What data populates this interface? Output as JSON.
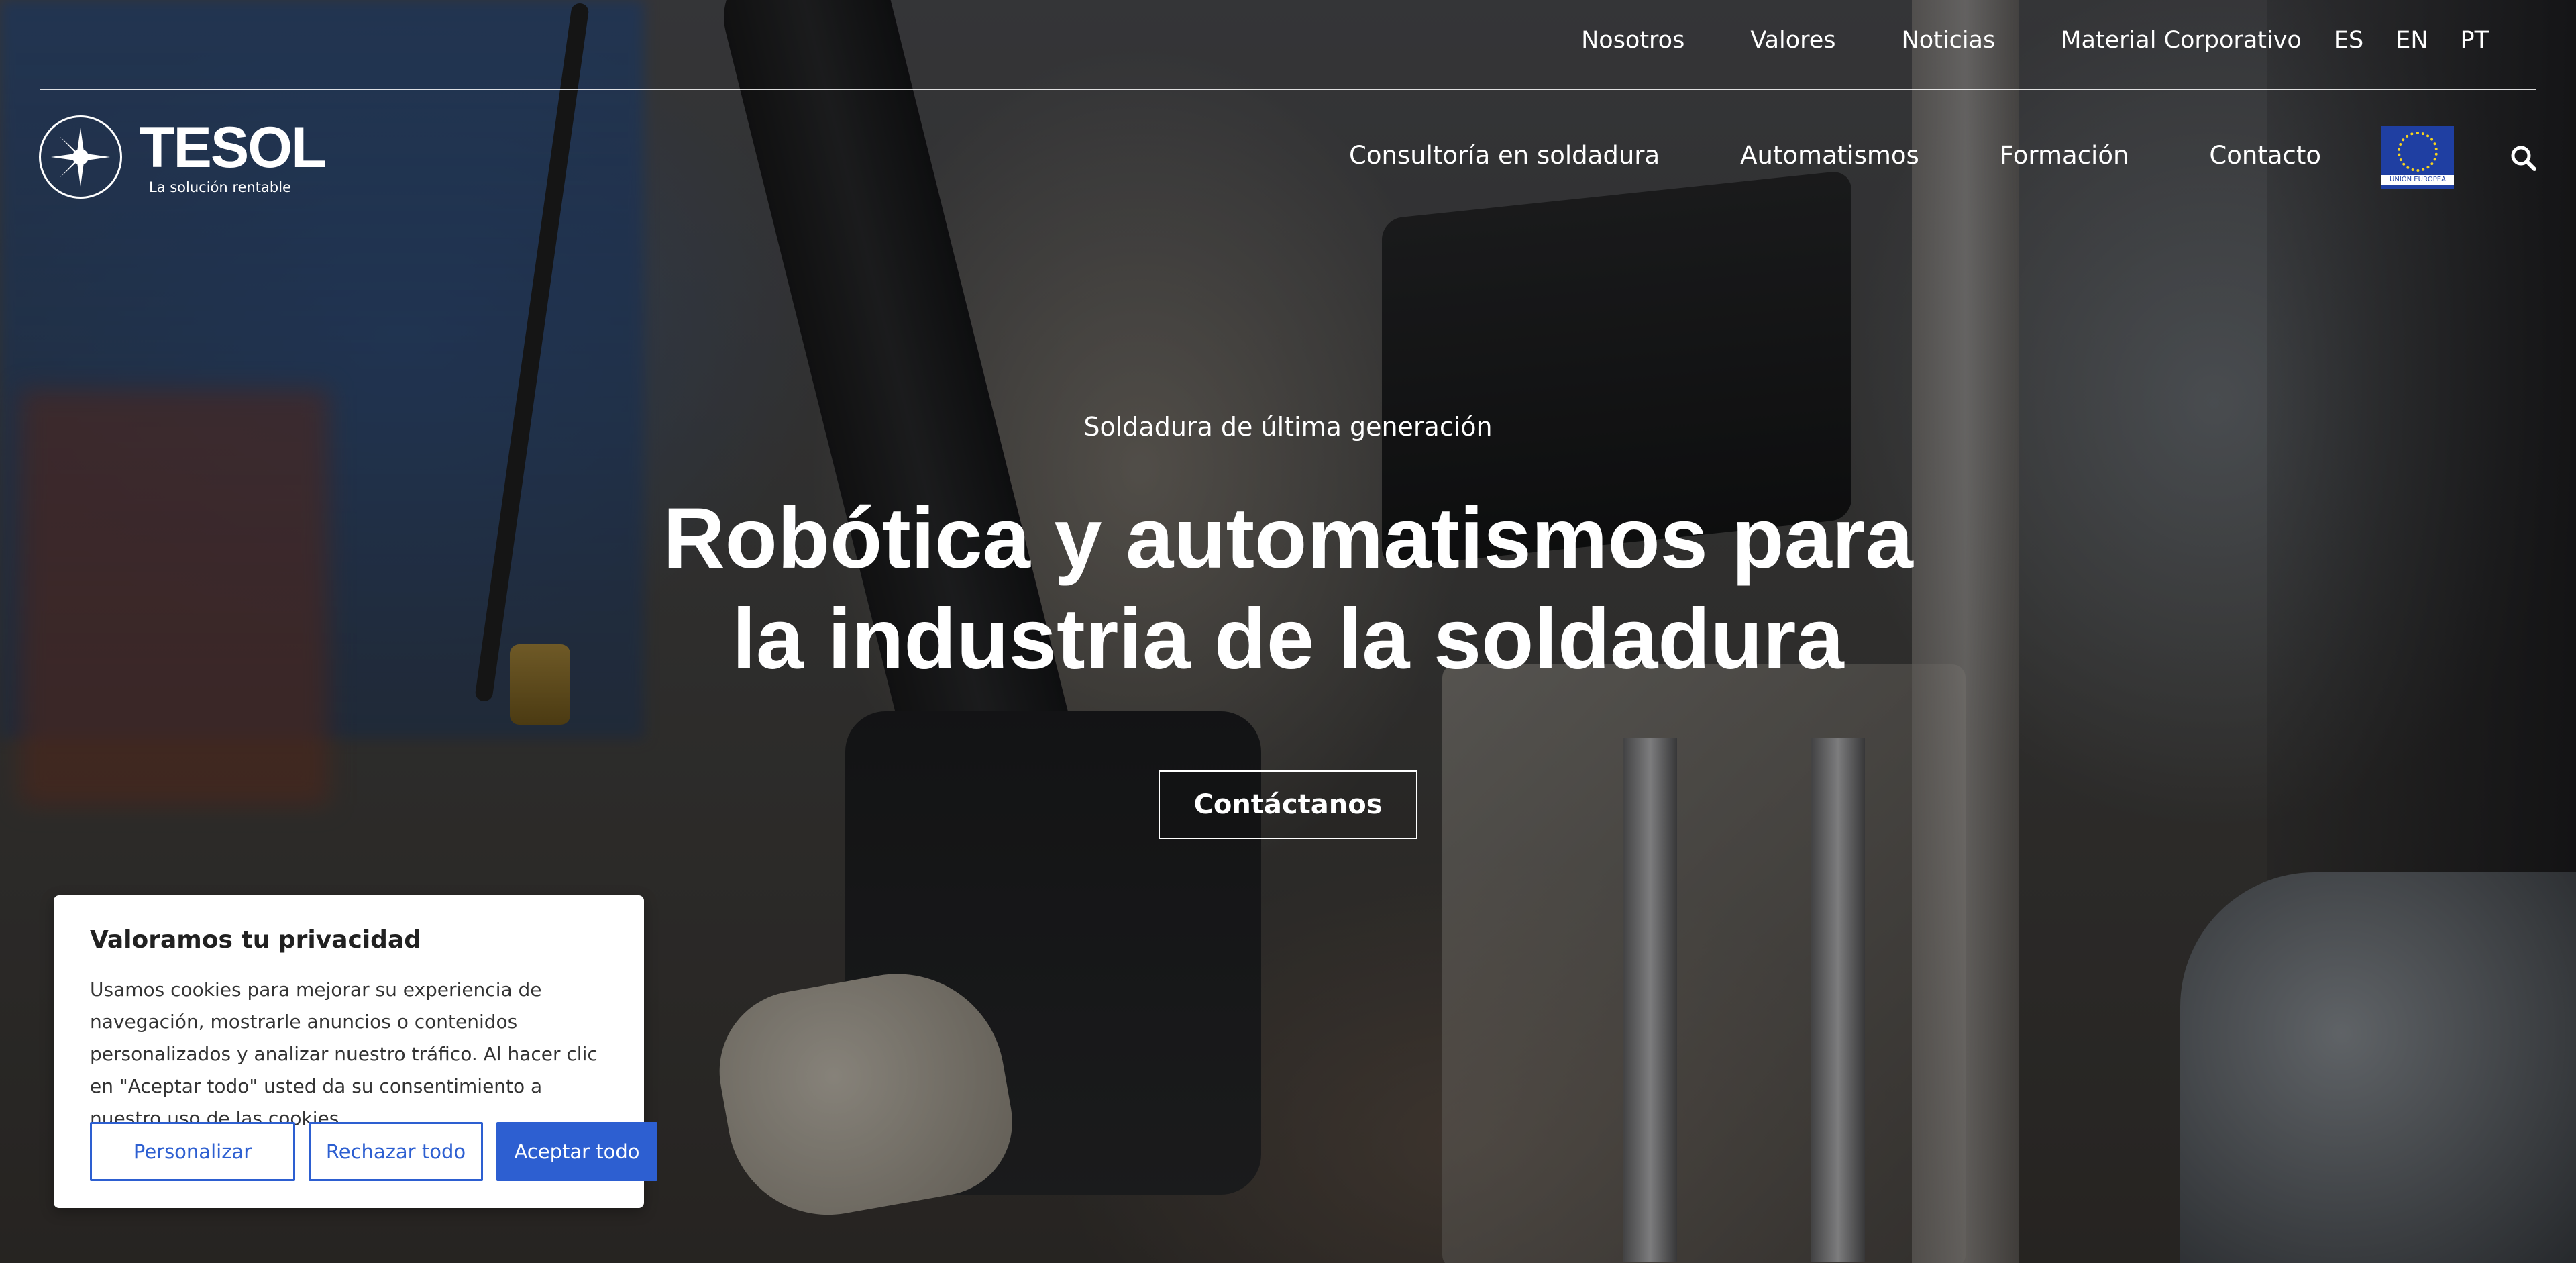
{
  "top_nav": {
    "items": [
      "Nosotros",
      "Valores",
      "Noticias",
      "Material Corporativo"
    ],
    "languages": [
      "ES",
      "EN",
      "PT"
    ]
  },
  "logo": {
    "name": "TESOL",
    "tagline": "La solución rentable"
  },
  "main_nav": {
    "items": [
      "Consultoría en soldadura",
      "Automatismos",
      "Formación",
      "Contacto"
    ],
    "eu_label": "UNIÓN EUROPEA"
  },
  "hero": {
    "eyebrow": "Soldadura de última generación",
    "title_line1": "Robótica y automatismos para",
    "title_line2": "la industria de la soldadura",
    "cta_label": "Contáctanos"
  },
  "cookie_banner": {
    "title": "Valoramos tu privacidad",
    "body": "Usamos cookies para mejorar su experiencia de navegación, mostrarle anuncios o contenidos personalizados y analizar nuestro tráfico. Al hacer clic en \"Aceptar todo\" usted da su consentimiento a nuestro uso de las cookies.",
    "buttons": {
      "customize": "Personalizar",
      "reject": "Rechazar todo",
      "accept": "Aceptar todo"
    }
  },
  "colors": {
    "accent_blue": "#2d5fd1",
    "eu_blue": "#1f3fa2",
    "text_on_hero": "#ffffff"
  },
  "icons": {
    "logo_mark": "compass-star-icon",
    "search": "search-icon"
  }
}
